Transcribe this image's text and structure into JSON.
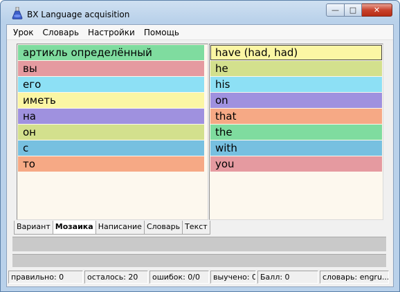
{
  "window": {
    "title": "BX Language acquisition",
    "min_glyph": "—",
    "max_glyph": "□",
    "close_glyph": "✕"
  },
  "menu": [
    "Урок",
    "Словарь",
    "Настройки",
    "Помощь"
  ],
  "left_words": [
    {
      "text": "артикль определённый",
      "color": "#7fdc9f"
    },
    {
      "text": "вы",
      "color": "#e59aa0"
    },
    {
      "text": "его",
      "color": "#8de0f5"
    },
    {
      "text": "иметь",
      "color": "#fbf6a4"
    },
    {
      "text": "на",
      "color": "#9f91df"
    },
    {
      "text": "он",
      "color": "#d3e08d"
    },
    {
      "text": "с",
      "color": "#77c0e0"
    },
    {
      "text": "то",
      "color": "#f6a985"
    }
  ],
  "right_words": [
    {
      "text": "have (had, had)",
      "color": "#fbf6a4",
      "selected": true
    },
    {
      "text": "he",
      "color": "#d3e08d"
    },
    {
      "text": "his",
      "color": "#8de0f5"
    },
    {
      "text": "on",
      "color": "#9f91df"
    },
    {
      "text": "that",
      "color": "#f6a985"
    },
    {
      "text": "the",
      "color": "#7fdc9f"
    },
    {
      "text": "with",
      "color": "#77c0e0"
    },
    {
      "text": "you",
      "color": "#e59aa0"
    }
  ],
  "tabs": [
    {
      "label": "Вариант",
      "active": false
    },
    {
      "label": "Мозаика",
      "active": true
    },
    {
      "label": "Написание",
      "active": false
    },
    {
      "label": "Словарь",
      "active": false
    },
    {
      "label": "Текст",
      "active": false
    }
  ],
  "status": [
    "правильно: 0",
    "осталось: 20",
    "ошибок: 0/0",
    "выучено: 0",
    "Балл: 0",
    "словарь: engru..."
  ]
}
